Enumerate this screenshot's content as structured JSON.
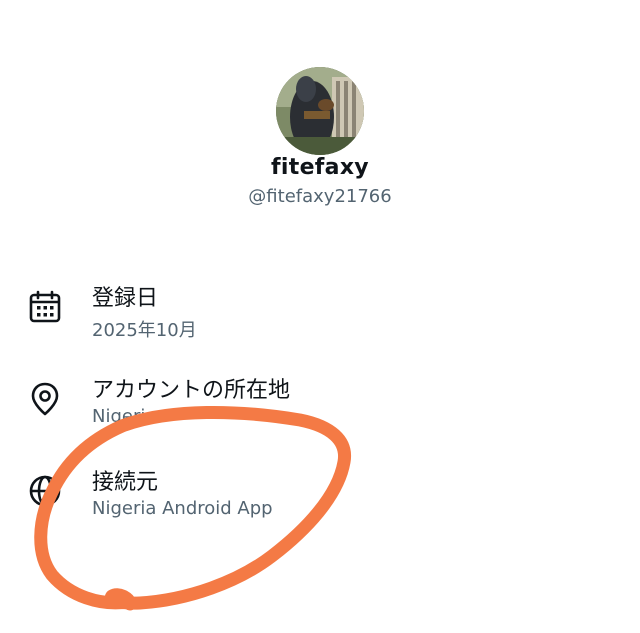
{
  "profile": {
    "display_name": "fitefaxy",
    "handle": "@fitefaxy21766",
    "avatar_icon": "profile-photo"
  },
  "about": {
    "joined": {
      "icon": "calendar-icon",
      "label": "登録日",
      "value": "2025年10月"
    },
    "location": {
      "icon": "location-pin-icon",
      "label": "アカウントの所在地",
      "value": "Nigeria"
    },
    "connected_via": {
      "icon": "globe-icon",
      "label": "接続元",
      "value": "Nigeria Android App"
    }
  },
  "colors": {
    "primary_text": "#0f1419",
    "secondary_text": "#536471",
    "annotation_stroke": "#f47a45"
  }
}
